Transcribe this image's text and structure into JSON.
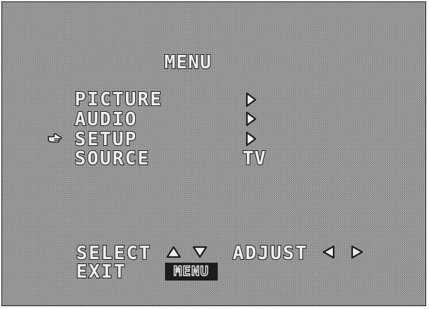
{
  "menu": {
    "title": "MENU",
    "items": [
      {
        "label": "PICTURE",
        "value_icon": "arrow-right-icon"
      },
      {
        "label": "AUDIO",
        "value_icon": "arrow-right-icon"
      },
      {
        "label": "SETUP",
        "value_icon": "arrow-right-icon",
        "selected": true
      },
      {
        "label": "SOURCE",
        "value": "TV"
      }
    ],
    "pointer_icon": "pointing-hand-icon"
  },
  "footer": {
    "select_label": "SELECT",
    "select_icons": [
      "arrow-up-icon",
      "arrow-down-icon"
    ],
    "adjust_label": "ADJUST",
    "adjust_icons": [
      "arrow-left-icon",
      "arrow-right-icon"
    ],
    "exit_label": "EXIT",
    "exit_key_label": "MENU"
  },
  "colors": {
    "background": "#cfcfcf",
    "outline": "#1c1c1c",
    "text_fill": "#ededed"
  }
}
